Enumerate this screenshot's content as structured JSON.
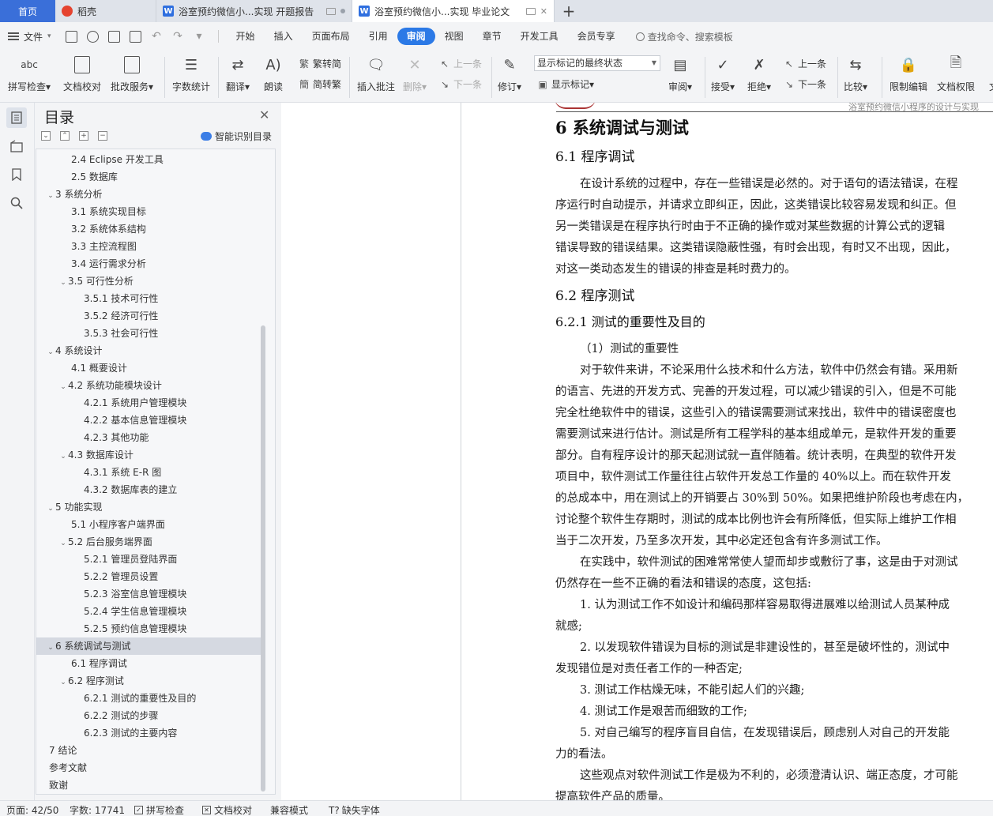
{
  "tabs": {
    "home": "首页",
    "straw": "稻壳",
    "doc1": "浴室预约微信小...实现 开题报告",
    "doc2": "浴室预约微信小...实现 毕业论文"
  },
  "menu": {
    "file": "文件",
    "tabs": [
      "开始",
      "插入",
      "页面布局",
      "引用",
      "审阅",
      "视图",
      "章节",
      "开发工具",
      "会员专享"
    ],
    "search": "查找命令、搜索模板"
  },
  "ribbon": {
    "spell_icon": "abc",
    "spell": "拼写检查",
    "proofread": "文档校对",
    "correction": "批改服务",
    "wordcount": "字数统计",
    "translate": "翻译",
    "read_aloud": "朗读",
    "trad": "繁转简",
    "simp": "简转繁",
    "insert_comment": "插入批注",
    "delete": "删除",
    "prev": "上一条",
    "next": "下一条",
    "revise": "修订",
    "markup_select": "显示标记的最终状态",
    "show_markup": "显示标记",
    "review": "审阅",
    "accept": "接受",
    "reject": "拒绝",
    "prev2": "上一条",
    "next2": "下一条",
    "compare": "比较",
    "restrict": "限制编辑",
    "permission": "文档权限",
    "more": "文"
  },
  "toc": {
    "title": "目录",
    "smart": "智能识别目录",
    "items": [
      {
        "label": "2.4 Eclipse 开发工具",
        "level": 2
      },
      {
        "label": "2.5 数据库",
        "level": 2
      },
      {
        "label": "3  系统分析",
        "level": 1,
        "exp": true
      },
      {
        "label": "3.1  系统实现目标",
        "level": 2
      },
      {
        "label": "3.2  系统体系结构",
        "level": 2
      },
      {
        "label": "3.3  主控流程图",
        "level": 2
      },
      {
        "label": "3.4  运行需求分析",
        "level": 2
      },
      {
        "label": "3.5  可行性分析",
        "level": 2,
        "exp": true
      },
      {
        "label": "3.5.1 技术可行性",
        "level": 3
      },
      {
        "label": "3.5.2 经济可行性",
        "level": 3
      },
      {
        "label": "3.5.3 社会可行性",
        "level": 3
      },
      {
        "label": "4  系统设计",
        "level": 1,
        "exp": true
      },
      {
        "label": "4.1  概要设计",
        "level": 2
      },
      {
        "label": "4.2  系统功能模块设计",
        "level": 2,
        "exp": true
      },
      {
        "label": "4.2.1  系统用户管理模块",
        "level": 3
      },
      {
        "label": "4.2.2  基本信息管理模块",
        "level": 3
      },
      {
        "label": "4.2.3  其他功能",
        "level": 3
      },
      {
        "label": "4.3  数据库设计",
        "level": 2,
        "exp": true
      },
      {
        "label": "4.3.1  系统 E-R 图",
        "level": 3
      },
      {
        "label": "4.3.2  数据库表的建立",
        "level": 3
      },
      {
        "label": "5  功能实现",
        "level": 1,
        "exp": true
      },
      {
        "label": "5.1  小程序客户端界面",
        "level": 2
      },
      {
        "label": "5.2  后台服务端界面",
        "level": 2,
        "exp": true
      },
      {
        "label": "5.2.1  管理员登陆界面",
        "level": 3
      },
      {
        "label": "5.2.2  管理员设置",
        "level": 3
      },
      {
        "label": "5.2.3  浴室信息管理模块",
        "level": 3
      },
      {
        "label": "5.2.4  学生信息管理模块",
        "level": 3
      },
      {
        "label": "5.2.5  预约信息管理模块",
        "level": 3
      },
      {
        "label": "6  系统调试与测试",
        "level": 1,
        "exp": true,
        "sel": true
      },
      {
        "label": "6.1  程序调试",
        "level": 2
      },
      {
        "label": "6.2  程序测试",
        "level": 2,
        "exp": true
      },
      {
        "label": "6.2.1  测试的重要性及目的",
        "level": 3
      },
      {
        "label": "6.2.2  测试的步骤",
        "level": 3
      },
      {
        "label": "6.2.3  测试的主要内容",
        "level": 3
      },
      {
        "label": "7  结论",
        "level": 1
      },
      {
        "label": "参考文献",
        "level": 1
      },
      {
        "label": "致谢",
        "level": 1
      }
    ]
  },
  "document": {
    "header_text": "浴室预约微信小程序的设计与实现",
    "h1": "6  系统调试与测试",
    "h2_1": "6.1  程序调试",
    "p1": [
      "在设计系统的过程中，存在一些错误是必然的。对于语句的语法错误，在程",
      "序运行时自动提示，并请求立即纠正，因此，这类错误比较容易发现和纠正。但",
      "另一类错误是在程序执行时由于不正确的操作或对某些数据的计算公式的逻辑",
      "错误导致的错误结果。这类错误隐蔽性强，有时会出现，有时又不出现，因此，",
      "对这一类动态发生的错误的排查是耗时费力的。"
    ],
    "h2_2": "6.2  程序测试",
    "h3_1": "6.2.1  测试的重要性及目的",
    "sub1": "（1）测试的重要性",
    "p2": [
      "对于软件来讲，不论采用什么技术和什么方法，软件中仍然会有错。采用新",
      "的语言、先进的开发方式、完善的开发过程，可以减少错误的引入，但是不可能",
      "完全杜绝软件中的错误，这些引入的错误需要测试来找出，软件中的错误密度也",
      "需要测试来进行估计。测试是所有工程学科的基本组成单元，是软件开发的重要",
      "部分。自有程序设计的那天起测试就一直伴随着。统计表明，在典型的软件开发",
      "项目中，软件测试工作量往往占软件开发总工作量的 40%以上。而在软件开发",
      "的总成本中，用在测试上的开销要占 30%到 50%。如果把维护阶段也考虑在内，",
      "讨论整个软件生存期时，测试的成本比例也许会有所降低，但实际上维护工作相",
      "当于二次开发，乃至多次开发，其中必定还包含有许多测试工作。"
    ],
    "p3": [
      "在实践中，软件测试的困难常常使人望而却步或敷衍了事，这是由于对测试",
      "仍然存在一些不正确的看法和错误的态度，这包括:"
    ],
    "list": [
      [
        "1. 认为测试工作不如设计和编码那样容易取得进展难以给测试人员某种成",
        "就感;"
      ],
      [
        "2. 以发现软件错误为目标的测试是非建设性的，甚至是破坏性的，测试中",
        "发现错位是对责任者工作的一种否定;"
      ],
      [
        "3. 测试工作枯燥无味，不能引起人们的兴趣;"
      ],
      [
        "4. 测试工作是艰苦而细致的工作;"
      ],
      [
        "5. 对自己编写的程序盲目自信，在发现错误后，顾虑别人对自己的开发能",
        "力的看法。"
      ]
    ],
    "p4": [
      "这些观点对软件测试工作是极为不利的，必须澄清认识、端正态度，才可能",
      "提高软件产品的质量。"
    ]
  },
  "status": {
    "page": "页面: 42/50",
    "words": "字数: 17741",
    "spell": "拼写检查",
    "proof": "文档校对",
    "compat": "兼容模式",
    "missing_font": "缺失字体"
  }
}
